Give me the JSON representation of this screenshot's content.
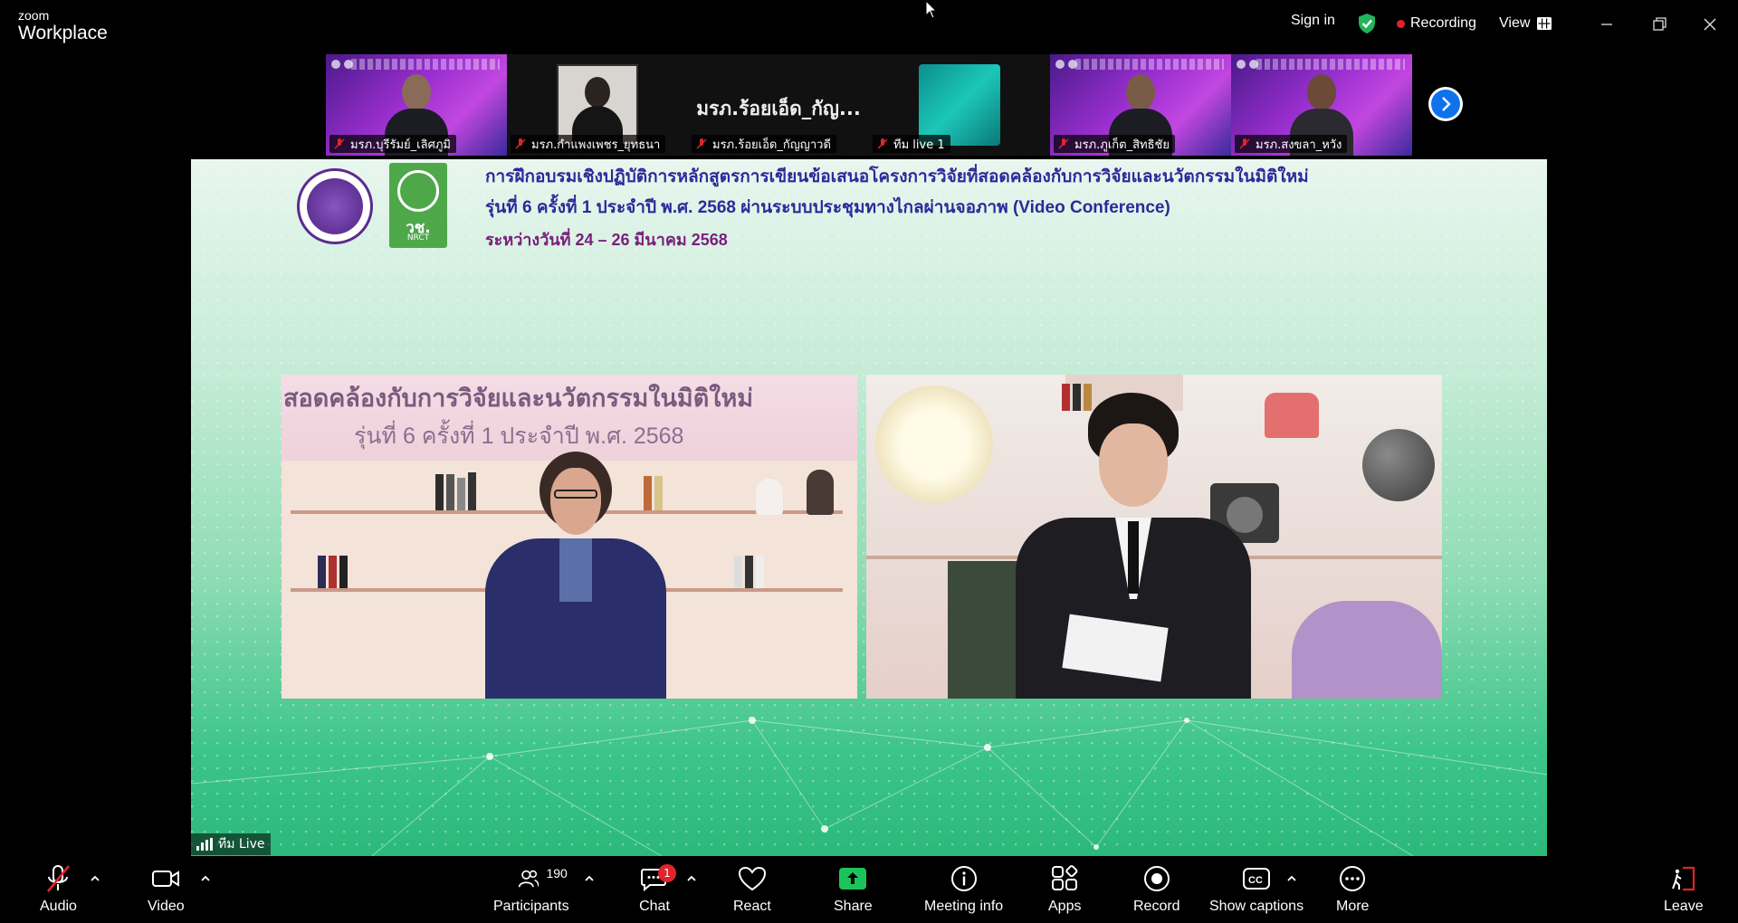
{
  "app": {
    "brand_small": "zoom",
    "brand_big": "Workplace"
  },
  "titlebar": {
    "sign_in": "Sign in",
    "recording": "Recording",
    "view": "View"
  },
  "thumbnails": [
    {
      "name": "มรภ.บุรีรัมย์_เลิศภูมิ"
    },
    {
      "name": "มรภ.กำแพงเพชร_ยุทธนา"
    },
    {
      "name": "มรภ.ร้อยเอ็ด_กัญญาวดี",
      "card_text": "มรภ.ร้อยเอ็ด_กัญ..."
    },
    {
      "name": "ทีม live 1"
    },
    {
      "name": "มรภ.ภูเก็ต_สิทธิชัย"
    },
    {
      "name": "มรภ.สงขลา_หวัง"
    }
  ],
  "stage": {
    "header_line1": "การฝึกอบรมเชิงปฏิบัติการหลักสูตรการเขียนข้อเสนอโครงการวิจัยที่สอดคล้องกับการวิจัยและนวัตกรรมในมิติใหม่",
    "header_line2": "รุ่นที่ 6 ครั้งที่ 1 ประจำปี พ.ศ. 2568 ผ่านระบบประชุมทางไกลผ่านจอภาพ (Video Conference)",
    "header_line3": "ระหว่างวันที่ 24 – 26 มีนาคม 2568",
    "emblem2_text": "วช.",
    "emblem2_sub": "NRCT",
    "panel_caption1": "สอดคล้องกับการวิจัยและนวัตกรรมในมิติใหม่",
    "panel_caption2": "รุ่นที่ 6 ครั้งที่ 1 ประจำปี พ.ศ. 2568",
    "active_speaker": "ทีม Live"
  },
  "toolbar": {
    "audio": "Audio",
    "video": "Video",
    "participants": "Participants",
    "participants_count": "190",
    "chat": "Chat",
    "chat_badge": "1",
    "react": "React",
    "share": "Share",
    "meeting_info": "Meeting info",
    "apps": "Apps",
    "record": "Record",
    "show_captions": "Show captions",
    "more": "More",
    "leave": "Leave"
  },
  "colors": {
    "share_green": "#1bc45a",
    "recording_red": "#e0242b",
    "next_blue": "#0e72ed",
    "leave_red": "#e0242b"
  }
}
